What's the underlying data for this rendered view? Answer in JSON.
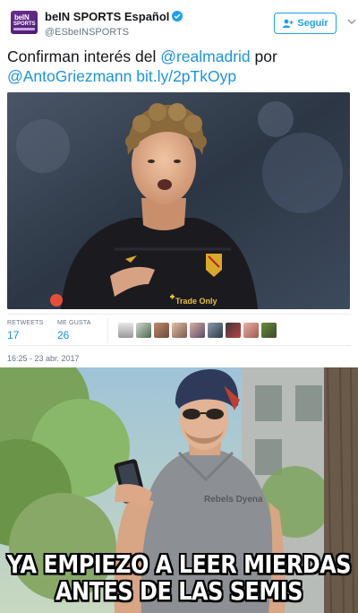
{
  "tweet": {
    "avatar": {
      "text_top": "beIN",
      "text_bottom": "SPORTS"
    },
    "display_name": "beIN SPORTS Español",
    "handle": "@ESbeINSPORTS",
    "follow_label": "Seguir",
    "text": {
      "part1": "Confirman interés del ",
      "mention1": "@realmadrid",
      "part2": " por ",
      "mention2": "@AntoGriezmann",
      "part3": " ",
      "url": "bit.ly/2pTkOyp"
    },
    "retweets_label": "RETWEETS",
    "retweets_count": "17",
    "likes_label": "ME GUSTA",
    "likes_count": "26",
    "timestamp": "16:25 - 23 abr. 2017",
    "jersey_sponsor": "Trade Only"
  },
  "meme": {
    "line1": "YA EMPIEZO A LEER MIERDAS",
    "line2": "ANTES DE LAS SEMIS",
    "shirt_text": "Rebels Dyena"
  },
  "colors": {
    "link": "#1b95e0",
    "follow": "#1da1f2",
    "secondary": "#657786",
    "brand_purple": "#5b2480"
  }
}
